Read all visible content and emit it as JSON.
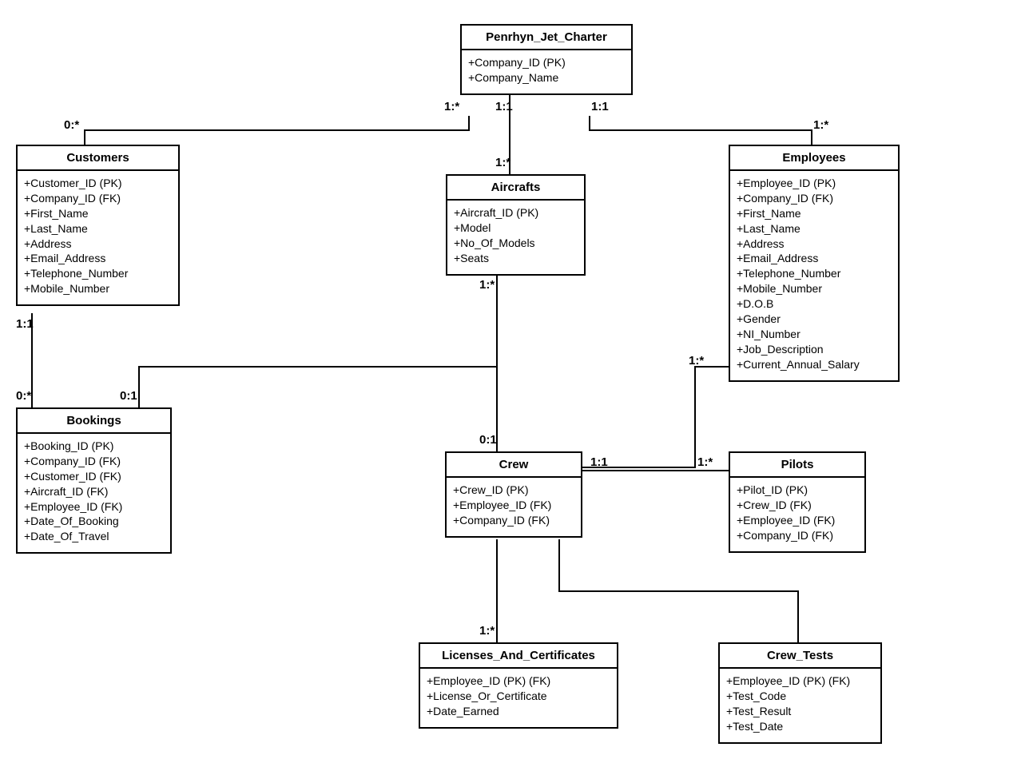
{
  "entities": {
    "penrhyn": {
      "title": "Penrhyn_Jet_Charter",
      "attrs": [
        "+Company_ID (PK)",
        "+Company_Name"
      ]
    },
    "customers": {
      "title": "Customers",
      "attrs": [
        "+Customer_ID (PK)",
        "+Company_ID (FK)",
        "+First_Name",
        "+Last_Name",
        "+Address",
        "+Email_Address",
        "+Telephone_Number",
        "+Mobile_Number"
      ]
    },
    "aircrafts": {
      "title": "Aircrafts",
      "attrs": [
        "+Aircraft_ID (PK)",
        "+Model",
        "+No_Of_Models",
        "+Seats"
      ]
    },
    "employees": {
      "title": "Employees",
      "attrs": [
        "+Employee_ID (PK)",
        "+Company_ID (FK)",
        "+First_Name",
        "+Last_Name",
        "+Address",
        "+Email_Address",
        "+Telephone_Number",
        "+Mobile_Number",
        "+D.O.B",
        "+Gender",
        "+NI_Number",
        "+Job_Description",
        "+Current_Annual_Salary"
      ]
    },
    "bookings": {
      "title": "Bookings",
      "attrs": [
        "+Booking_ID (PK)",
        "+Company_ID (FK)",
        "+Customer_ID (FK)",
        "+Aircraft_ID (FK)",
        "+Employee_ID (FK)",
        "+Date_Of_Booking",
        "+Date_Of_Travel"
      ]
    },
    "crew": {
      "title": "Crew",
      "attrs": [
        "+Crew_ID (PK)",
        "+Employee_ID (FK)",
        "+Company_ID (FK)"
      ]
    },
    "pilots": {
      "title": "Pilots",
      "attrs": [
        "+Pilot_ID (PK)",
        "+Crew_ID (FK)",
        "+Employee_ID (FK)",
        "+Company_ID (FK)"
      ]
    },
    "licenses": {
      "title": "Licenses_And_Certificates",
      "attrs": [
        "+Employee_ID (PK) (FK)",
        "+License_Or_Certificate",
        "+Date_Earned"
      ]
    },
    "crewtests": {
      "title": "Crew_Tests",
      "attrs": [
        "+Employee_ID (PK) (FK)",
        "+Test_Code",
        "+Test_Result",
        "+Test_Date"
      ]
    }
  },
  "labels": {
    "l1": "1:*",
    "l2": "1:1",
    "l3": "1:1",
    "l4": "0:*",
    "l5": "1:*",
    "l6": "1:*",
    "l7": "1:1",
    "l8": "1:*",
    "l9": "0:*",
    "l10": "0:1",
    "l11": "1:*",
    "l12": "0:1",
    "l13": "1:1",
    "l14": "1:*",
    "l15": "1:*"
  }
}
